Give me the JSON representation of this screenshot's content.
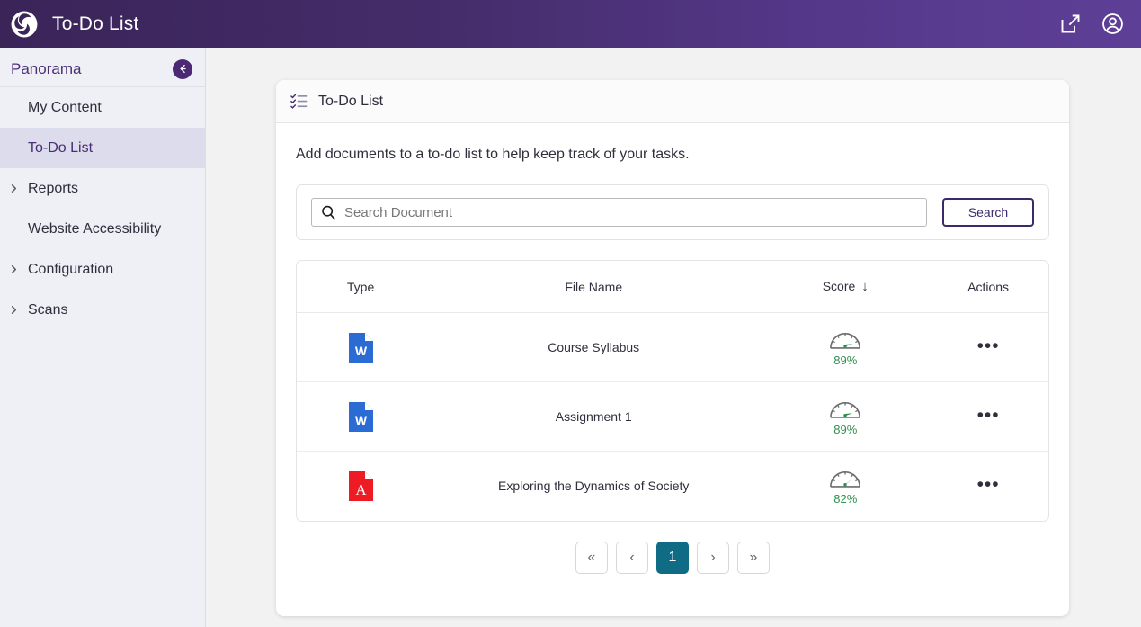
{
  "topbar": {
    "logo_icon": "swirl-logo-icon",
    "title": "To-Do List",
    "open_external_icon": "external-link-icon",
    "account_icon": "user-account-icon",
    "gradient_from": "#3a2458",
    "gradient_to": "#5e3f97"
  },
  "sidebar": {
    "title": "Panorama",
    "collapse_icon": "arrow-left-icon",
    "active_bg": "#dcdcec",
    "items": [
      {
        "label": "My Content",
        "expandable": false,
        "active": false
      },
      {
        "label": "To-Do List",
        "expandable": false,
        "active": true
      },
      {
        "label": "Reports",
        "expandable": true,
        "active": false
      },
      {
        "label": "Website Accessibility",
        "expandable": false,
        "active": false
      },
      {
        "label": "Configuration",
        "expandable": true,
        "active": false
      },
      {
        "label": "Scans",
        "expandable": true,
        "active": false
      }
    ]
  },
  "card": {
    "header_icon": "checklist-icon",
    "header_title": "To-Do List",
    "intro": "Add documents to a to-do list to help keep track of your tasks.",
    "search": {
      "icon": "search-icon",
      "placeholder": "Search Document",
      "value": "",
      "button_label": "Search",
      "button_border": "#3b2a6b"
    },
    "table": {
      "columns": [
        {
          "label": "Type",
          "sorted": false
        },
        {
          "label": "File Name",
          "sorted": false
        },
        {
          "label": "Score",
          "sorted": true,
          "sort_arrow": "↓"
        },
        {
          "label": "Actions",
          "sorted": false
        }
      ],
      "rows": [
        {
          "file_type": "word-document-icon",
          "file_name": "Course Syllabus",
          "score": "89%",
          "score_number": 89,
          "actions_icon": "ellipsis-menu-icon"
        },
        {
          "file_type": "word-document-icon",
          "file_name": "Assignment 1",
          "score": "89%",
          "score_number": 89,
          "actions_icon": "ellipsis-menu-icon"
        },
        {
          "file_type": "pdf-document-icon",
          "file_name": "Exploring the Dynamics of Society",
          "score": "82%",
          "score_number": 82,
          "actions_icon": "ellipsis-menu-icon"
        }
      ]
    },
    "pagination": {
      "first_label": "«",
      "prev_label": "‹",
      "current_page": "1",
      "next_label": "›",
      "last_label": "»",
      "active_color": "#106c84"
    }
  }
}
